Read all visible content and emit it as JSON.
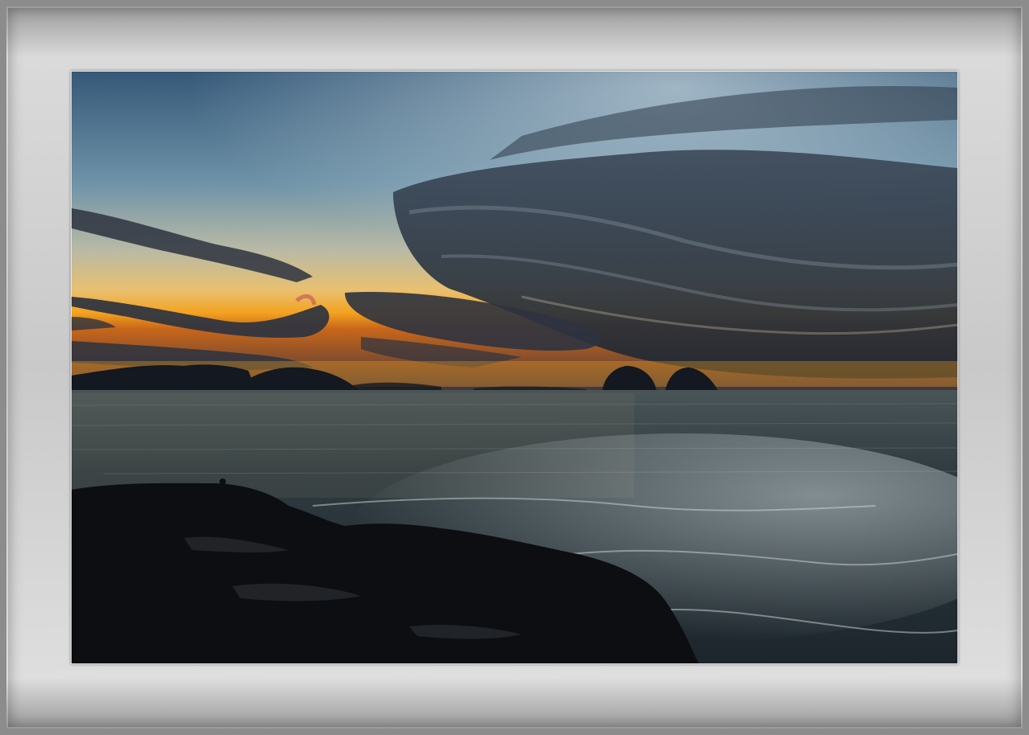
{
  "photo": {
    "subject": "sunset-over-sea",
    "colors": {
      "sky_top": "#3a5a78",
      "sky_mid": "#7fa0b0",
      "horizon_glow": "#f2a020",
      "cloud_dark": "#2a3340",
      "sea": "#2a3a40",
      "rocks": "#0e0f12",
      "frame": "#c9c9c9"
    }
  }
}
